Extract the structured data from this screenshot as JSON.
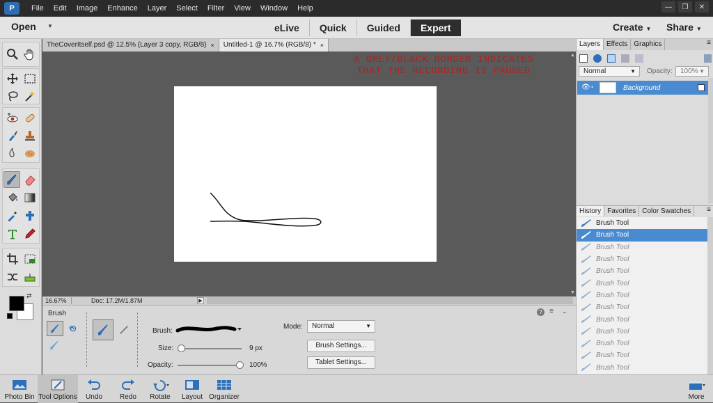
{
  "menubar": {
    "logo": "P",
    "items": [
      "File",
      "Edit",
      "Image",
      "Enhance",
      "Layer",
      "Select",
      "Filter",
      "View",
      "Window",
      "Help"
    ]
  },
  "modebar": {
    "open_label": "Open",
    "modes": [
      {
        "label": "eLive",
        "active": false
      },
      {
        "label": "Quick",
        "active": false
      },
      {
        "label": "Guided",
        "active": false
      },
      {
        "label": "Expert",
        "active": true
      }
    ],
    "create_label": "Create",
    "share_label": "Share"
  },
  "document": {
    "tabs": [
      {
        "label": "TheCoverItself.psd @ 12.5% (Layer 3 copy, RGB/8)",
        "close": "×"
      },
      {
        "label": "Untitled-1 @ 16.7% (RGB/8) *",
        "close": "×"
      }
    ],
    "annotation_line1": "A GREY/BLACK BORDER INDICATES",
    "annotation_line2": "THAT THE RECORDING IS PAUSED",
    "zoom": "16.67%",
    "doc_info": "Doc: 17.2M/1.87M"
  },
  "tool_options": {
    "tool_name": "Brush",
    "brush_label": "Brush:",
    "size_label": "Size:",
    "size_value": "9 px",
    "opacity_label": "Opacity:",
    "opacity_value": "100%",
    "mode_label": "Mode:",
    "mode_value": "Normal",
    "brush_settings_label": "Brush Settings...",
    "tablet_settings_label": "Tablet Settings..."
  },
  "layers_panel": {
    "tabs": [
      "Layers",
      "Effects",
      "Graphics"
    ],
    "blend_mode": "Normal",
    "opacity_label": "Opacity:",
    "opacity_value": "100%",
    "layer_name": "Background"
  },
  "history_panel": {
    "tabs": [
      "History",
      "Favorites",
      "Color Swatches"
    ],
    "items": [
      {
        "label": "Brush Tool",
        "state": "normal"
      },
      {
        "label": "Brush Tool",
        "state": "selected"
      },
      {
        "label": "Brush Tool",
        "state": "undone"
      },
      {
        "label": "Brush Tool",
        "state": "undone"
      },
      {
        "label": "Brush Tool",
        "state": "undone"
      },
      {
        "label": "Brush Tool",
        "state": "undone"
      },
      {
        "label": "Brush Tool",
        "state": "undone"
      },
      {
        "label": "Brush Tool",
        "state": "undone"
      },
      {
        "label": "Brush Tool",
        "state": "undone"
      },
      {
        "label": "Brush Tool",
        "state": "undone"
      },
      {
        "label": "Brush Tool",
        "state": "undone"
      },
      {
        "label": "Brush Tool",
        "state": "undone"
      },
      {
        "label": "Brush Tool",
        "state": "undone"
      }
    ]
  },
  "taskbar": {
    "photo_bin": "Photo Bin",
    "tool_options": "Tool Options",
    "undo": "Undo",
    "redo": "Redo",
    "rotate": "Rotate",
    "layout": "Layout",
    "organizer": "Organizer",
    "more": "More"
  },
  "colors": {
    "accent_blue": "#4a8ad0",
    "annotation_red": "#b32020",
    "foreground": "#000000",
    "background": "#ffffff"
  }
}
